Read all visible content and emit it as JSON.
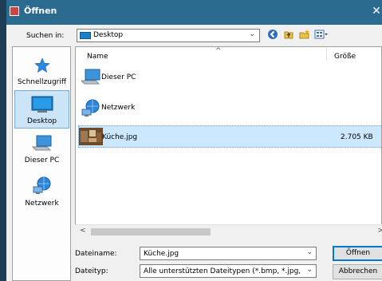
{
  "window": {
    "title": "Öffnen",
    "close_glyph": "✕"
  },
  "lookin": {
    "label": "Suchen in:",
    "value": "Desktop"
  },
  "places": [
    {
      "label": "Schnellzugriff",
      "icon": "star-icon"
    },
    {
      "label": "Desktop",
      "icon": "desktop-icon",
      "selected": true
    },
    {
      "label": "Dieser PC",
      "icon": "computer-icon"
    },
    {
      "label": "Netzwerk",
      "icon": "network-icon"
    }
  ],
  "list": {
    "columns": {
      "name": "Name",
      "size": "Größe"
    },
    "items": [
      {
        "name": "Dieser PC",
        "size": "",
        "icon": "computer-icon"
      },
      {
        "name": "Netzwerk",
        "size": "",
        "icon": "network-icon"
      },
      {
        "name": "Küche.jpg",
        "size": "2.705 KB",
        "icon": "image-thumbnail",
        "selected": true
      }
    ]
  },
  "filename": {
    "label": "Dateiname:",
    "value": "Küche.jpg"
  },
  "filetype": {
    "label": "Dateityp:",
    "value": "Alle unterstützten Dateitypen (*.bmp, *.jpg, *.jpe"
  },
  "buttons": {
    "open": "Öffnen",
    "cancel": "Abbrechen"
  },
  "colors": {
    "titlebar": "#2a6b8f",
    "selection": "#cce8ff",
    "accent": "#0078d7"
  }
}
